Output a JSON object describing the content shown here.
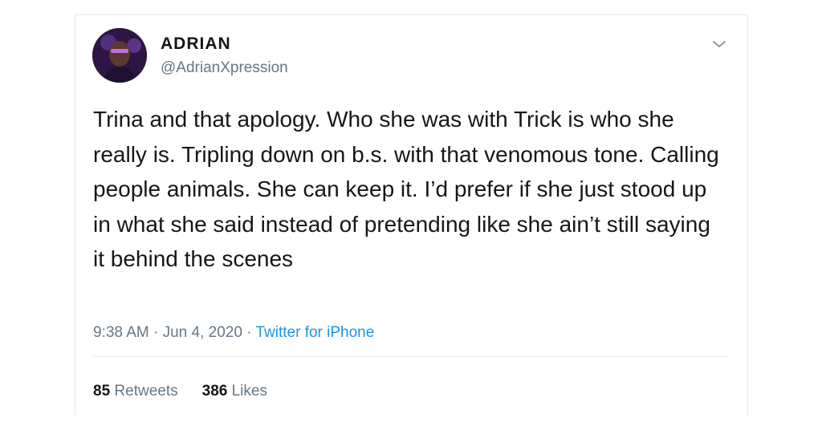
{
  "user": {
    "display_name": "ADRIAN",
    "handle": "@AdrianXpression"
  },
  "tweet": {
    "text": "Trina and that apology. Who she was with Trick is who she really is. Tripling down on b.s. with that venomous tone. Calling people animals. She can keep it. I’d prefer if she just stood up in what she said instead of pretending like she ain’t still saying it behind the scenes",
    "time": "9:38 AM",
    "date": "Jun 4, 2020",
    "source": "Twitter for iPhone",
    "separator": "·"
  },
  "stats": {
    "retweets_count": "85",
    "retweets_label": "Retweets",
    "likes_count": "386",
    "likes_label": "Likes"
  },
  "icons": {
    "caret": "chevron-down-icon"
  },
  "colors": {
    "text": "#14171a",
    "secondary": "#657786",
    "link": "#1b95e0",
    "border": "#e1e8ed"
  }
}
